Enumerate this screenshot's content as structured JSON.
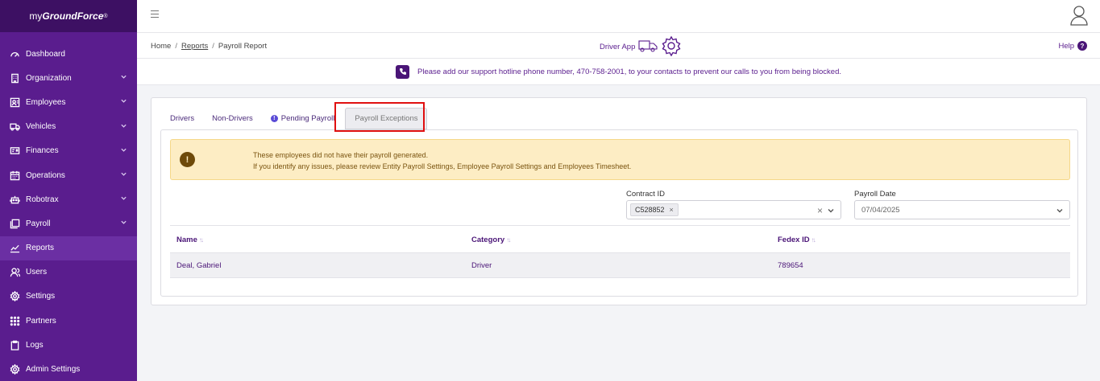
{
  "brand": {
    "prefix": "my",
    "name": "GroundForce",
    "mark": "®"
  },
  "sidebar": {
    "items": [
      {
        "label": "Dashboard",
        "icon": "dashboard-icon",
        "expandable": false
      },
      {
        "label": "Organization",
        "icon": "building-icon",
        "expandable": true
      },
      {
        "label": "Employees",
        "icon": "employees-icon",
        "expandable": true
      },
      {
        "label": "Vehicles",
        "icon": "truck-icon",
        "expandable": true
      },
      {
        "label": "Finances",
        "icon": "finances-icon",
        "expandable": true
      },
      {
        "label": "Operations",
        "icon": "calendar-icon",
        "expandable": true
      },
      {
        "label": "Robotrax",
        "icon": "robot-icon",
        "expandable": true
      },
      {
        "label": "Payroll",
        "icon": "payroll-icon",
        "expandable": true
      },
      {
        "label": "Reports",
        "icon": "chart-icon",
        "expandable": false,
        "active": true
      },
      {
        "label": "Users",
        "icon": "users-icon",
        "expandable": false
      },
      {
        "label": "Settings",
        "icon": "gear-icon",
        "expandable": false
      },
      {
        "label": "Partners",
        "icon": "grid-icon",
        "expandable": false
      },
      {
        "label": "Logs",
        "icon": "clipboard-icon",
        "expandable": false
      },
      {
        "label": "Admin Settings",
        "icon": "admin-gear-icon",
        "expandable": false
      }
    ]
  },
  "breadcrumb": {
    "home": "Home",
    "reports": "Reports",
    "current": "Payroll Report",
    "sep": "/"
  },
  "header": {
    "driver_app": "Driver App",
    "help": "Help",
    "help_mark": "?"
  },
  "hotline": {
    "message": "Please add our support hotline phone number, 470-758-2001, to your contacts to prevent our calls to you from being blocked."
  },
  "tabs": {
    "drivers": "Drivers",
    "non_drivers": "Non-Drivers",
    "pending": "Pending Payroll",
    "exceptions": "Payroll Exceptions"
  },
  "alert": {
    "mark": "!",
    "line1": "These employees did not have their payroll generated.",
    "line2": "If you identify any issues, please review Entity Payroll Settings, Employee Payroll Settings and Employees Timesheet."
  },
  "filters": {
    "contract_label": "Contract ID",
    "contract_chip": "C528852",
    "chip_remove": "×",
    "clear": "×",
    "date_label": "Payroll Date",
    "date_value": "07/04/2025"
  },
  "table": {
    "columns": [
      "Name",
      "Category",
      "Fedex ID"
    ],
    "rows": [
      {
        "name": "Deal, Gabriel",
        "category": "Driver",
        "fedex_id": "789654"
      }
    ]
  },
  "colors": {
    "sidebar": "#5a1d8e",
    "accent": "#4a1577",
    "alert_bg": "#fdedc4",
    "highlight": "#e01010"
  }
}
